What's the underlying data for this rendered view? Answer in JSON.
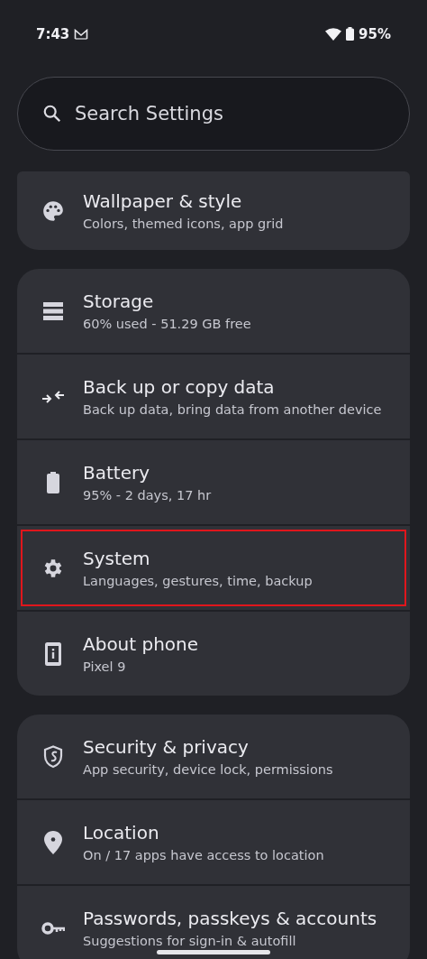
{
  "status_bar": {
    "time": "7:43",
    "battery": "95%"
  },
  "search": {
    "placeholder": "Search Settings"
  },
  "groups": [
    {
      "items": [
        {
          "title": "Wallpaper & style",
          "subtitle": "Colors, themed icons, app grid",
          "highlighted": false
        }
      ]
    },
    {
      "items": [
        {
          "title": "Storage",
          "subtitle": "60% used - 51.29 GB free",
          "highlighted": false
        },
        {
          "title": "Back up or copy data",
          "subtitle": "Back up data, bring data from another device",
          "highlighted": false
        },
        {
          "title": "Battery",
          "subtitle": "95% - 2 days, 17 hr",
          "highlighted": false
        },
        {
          "title": "System",
          "subtitle": "Languages, gestures, time, backup",
          "highlighted": true
        },
        {
          "title": "About phone",
          "subtitle": "Pixel 9",
          "highlighted": false
        }
      ]
    },
    {
      "items": [
        {
          "title": "Security & privacy",
          "subtitle": "App security, device lock, permissions",
          "highlighted": false
        },
        {
          "title": "Location",
          "subtitle": "On / 17 apps have access to location",
          "highlighted": false
        },
        {
          "title": "Passwords, passkeys & accounts",
          "subtitle": "Suggestions for sign-in & autofill",
          "highlighted": false
        }
      ]
    }
  ]
}
